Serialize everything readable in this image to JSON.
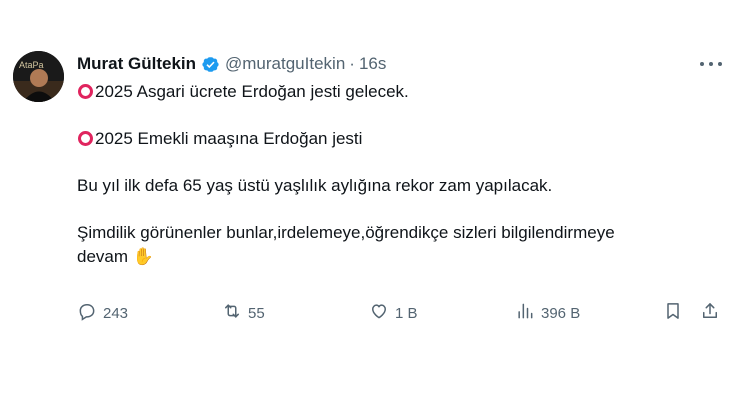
{
  "author": {
    "name": "Murat Gültekin",
    "handle": "@muratguItekin",
    "separator": "·",
    "time": "16s",
    "avatar_text": "AtaPa"
  },
  "tweet": {
    "lines": [
      "2025 Asgari ücrete Erdoğan jesti gelecek.",
      "2025 Emekli maaşına Erdoğan jesti",
      "Bu yıl ilk defa 65 yaş üstü yaşlılık aylığına rekor zam yapılacak.",
      "Şimdilik görünenler bunlar,irdelemeye,öğrendikçe sizleri bilgilendirmeye",
      "devam"
    ],
    "emoji": "✋"
  },
  "actions": {
    "replies": "243",
    "reposts": "55",
    "likes": "1 B",
    "views": "396 B"
  },
  "colors": {
    "text": "#0f1419",
    "secondary": "#536471",
    "verified": "#1d9bf0",
    "circle": "#e0245e"
  }
}
